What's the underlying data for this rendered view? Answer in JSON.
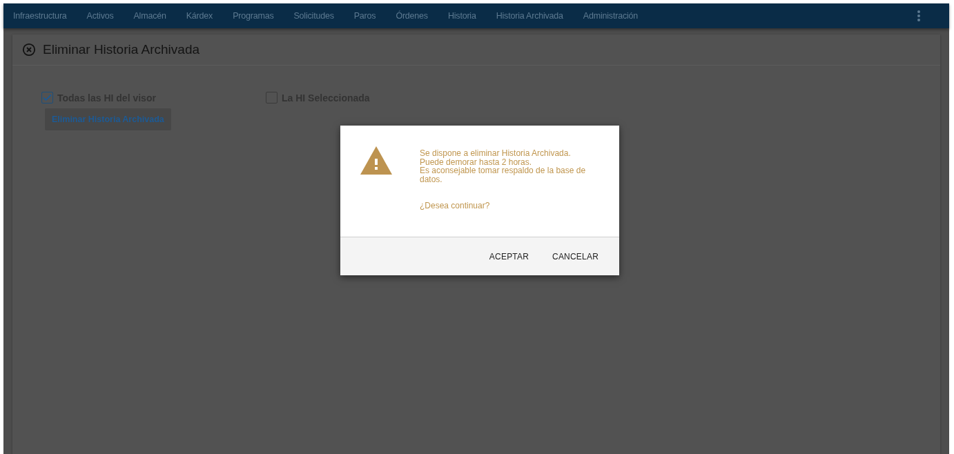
{
  "nav": {
    "items": [
      {
        "label": "Infraestructura"
      },
      {
        "label": "Activos"
      },
      {
        "label": "Almacén"
      },
      {
        "label": "Kárdex"
      },
      {
        "label": "Programas"
      },
      {
        "label": "Solicitudes"
      },
      {
        "label": "Paros"
      },
      {
        "label": "Órdenes"
      },
      {
        "label": "Historia"
      },
      {
        "label": "Historia Archivada"
      },
      {
        "label": "Administración"
      }
    ]
  },
  "panel": {
    "title": "Eliminar Historia Archivada",
    "options": [
      {
        "label": "Todas las HI del visor",
        "checked": true
      },
      {
        "label": "La HI Seleccionada",
        "checked": false
      }
    ],
    "button": "Eliminar Historia Archivada"
  },
  "dialog": {
    "message": [
      "Se dispone a eliminar Historia Archivada.",
      "Puede demorar hasta 2 horas.",
      "Es aconsejable tomar respaldo de la base de datos."
    ],
    "question": "¿Desea continuar?",
    "buttons": [
      "ACEPTAR",
      "CANCELAR"
    ]
  }
}
